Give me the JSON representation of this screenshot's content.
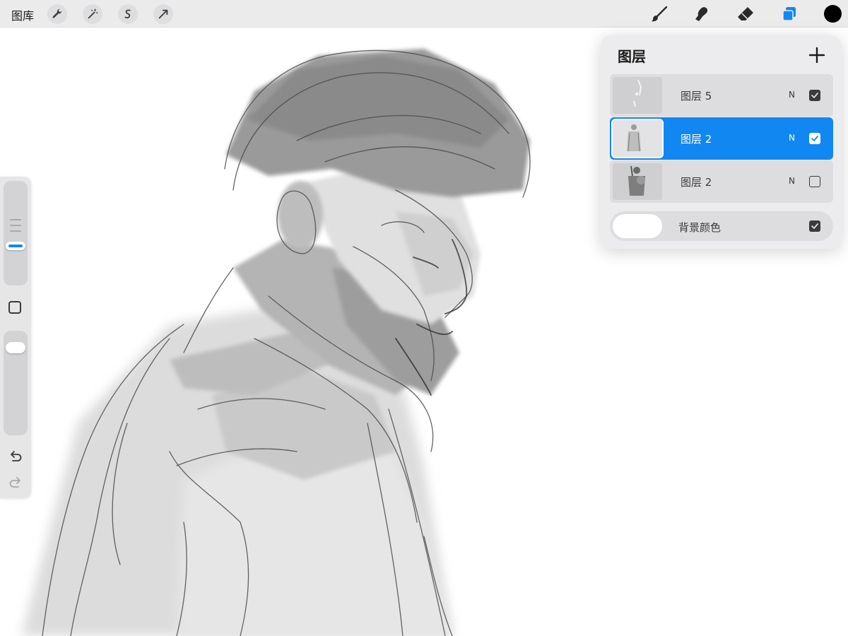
{
  "topbar": {
    "gallery_label": "图库",
    "left_tools": [
      "wrench-icon",
      "magic-wand-icon",
      "selection-icon",
      "transform-arrow-icon"
    ],
    "right_tools": [
      "brush-icon",
      "smudge-icon",
      "eraser-icon",
      "layers-icon"
    ],
    "current_color": "#000000",
    "active_tool_color": "#1187f2"
  },
  "sidebar": {
    "size_slider_value": 0.28,
    "opacity_slider_value": 0.08,
    "accent_color": "#1187f2"
  },
  "layers_panel": {
    "title": "图层",
    "layers": [
      {
        "name": "图层 5",
        "blend": "N",
        "visible": true,
        "selected": false
      },
      {
        "name": "图层 2",
        "blend": "N",
        "visible": true,
        "selected": true
      },
      {
        "name": "图层 2",
        "blend": "N",
        "visible": false,
        "selected": false
      }
    ],
    "background": {
      "name": "背景颜色",
      "color": "#ffffff",
      "visible": true
    }
  }
}
